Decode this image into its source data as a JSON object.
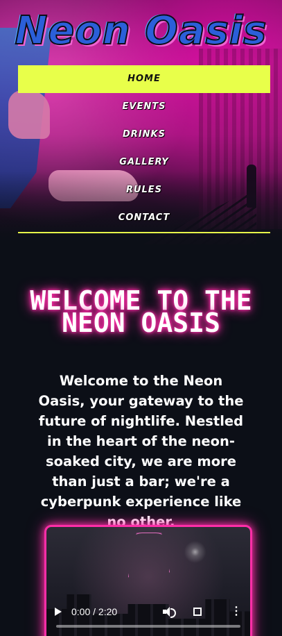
{
  "site": {
    "title": "Neon Oasis"
  },
  "nav": {
    "items": [
      {
        "label": "HOME",
        "active": true
      },
      {
        "label": "EVENTS",
        "active": false
      },
      {
        "label": "DRINKS",
        "active": false
      },
      {
        "label": "GALLERY",
        "active": false
      },
      {
        "label": "RULES",
        "active": false
      },
      {
        "label": "CONTACT",
        "active": false
      }
    ]
  },
  "main": {
    "heading": "WELCOME TO THE NEON OASIS",
    "intro": "Welcome to the Neon Oasis, your gateway to the future of nightlife. Nestled in the heart of the neon-soaked city, we are more than just a bar; we're a cyberpunk experience like no other."
  },
  "video": {
    "time": "0:00 / 2:20",
    "controls": [
      "play-icon",
      "volume-icon",
      "fullscreen-icon",
      "more-options-icon"
    ]
  },
  "colors": {
    "accent_yellow": "#e8ff4a",
    "neon_pink": "#ff2ea8",
    "title_blue": "#2b5fd9",
    "background": "#0c0f17"
  }
}
